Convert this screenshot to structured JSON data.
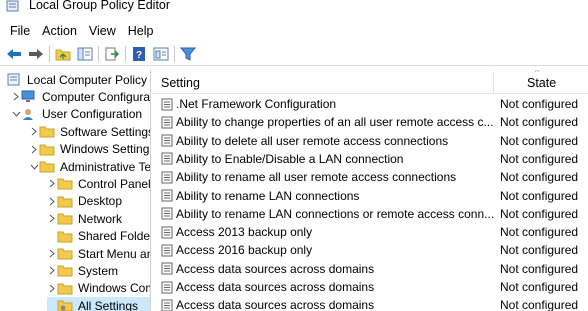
{
  "window": {
    "title": "Local Group Policy Editor"
  },
  "menu": [
    "File",
    "Action",
    "View",
    "Help"
  ],
  "toolbar": [
    {
      "name": "back-button",
      "icon": "arrow-left-icon"
    },
    {
      "name": "forward-button",
      "icon": "arrow-right-icon"
    },
    {
      "name": "up-folder-button",
      "icon": "up-folder-icon"
    },
    {
      "name": "show-hide-tree-button",
      "icon": "console-tree-icon"
    },
    {
      "name": "export-list-button",
      "icon": "export-icon"
    },
    {
      "name": "help-button",
      "icon": "help-icon"
    },
    {
      "name": "extended-view-button",
      "icon": "properties-icon"
    },
    {
      "name": "filter-button",
      "icon": "filter-icon"
    }
  ],
  "tree": [
    {
      "label": "Local Computer Policy",
      "indent": 0,
      "chev": "none",
      "icon": "computer-policy-icon"
    },
    {
      "label": "Computer Configuration",
      "indent": 1,
      "chev": "right",
      "icon": "computer-icon"
    },
    {
      "label": "User Configuration",
      "indent": 1,
      "chev": "down",
      "icon": "user-icon"
    },
    {
      "label": "Software Settings",
      "indent": 2,
      "chev": "right",
      "icon": "folder-icon"
    },
    {
      "label": "Windows Settings",
      "indent": 2,
      "chev": "right",
      "icon": "folder-icon"
    },
    {
      "label": "Administrative Templates",
      "indent": 2,
      "chev": "down",
      "icon": "folder-icon"
    },
    {
      "label": "Control Panel",
      "indent": 3,
      "chev": "right",
      "icon": "folder-icon"
    },
    {
      "label": "Desktop",
      "indent": 3,
      "chev": "right",
      "icon": "folder-icon"
    },
    {
      "label": "Network",
      "indent": 3,
      "chev": "right",
      "icon": "folder-icon"
    },
    {
      "label": "Shared Folders",
      "indent": 3,
      "chev": "none",
      "icon": "folder-icon"
    },
    {
      "label": "Start Menu and Taskbar",
      "indent": 3,
      "chev": "right",
      "icon": "folder-icon"
    },
    {
      "label": "System",
      "indent": 3,
      "chev": "right",
      "icon": "folder-icon"
    },
    {
      "label": "Windows Components",
      "indent": 3,
      "chev": "right",
      "icon": "folder-icon"
    },
    {
      "label": "All Settings",
      "indent": 3,
      "chev": "none",
      "icon": "all-settings-icon",
      "selected": true
    }
  ],
  "list": {
    "columns": {
      "setting": "Setting",
      "state": "State"
    },
    "rows": [
      {
        "setting": ".Net Framework Configuration",
        "state": "Not configured"
      },
      {
        "setting": "Ability to change properties of an all user remote access connections",
        "state": "Not configured"
      },
      {
        "setting": "Ability to delete all user remote access connections",
        "state": "Not configured"
      },
      {
        "setting": "Ability to Enable/Disable a LAN connection",
        "state": "Not configured"
      },
      {
        "setting": "Ability to rename all user remote access connections",
        "state": "Not configured"
      },
      {
        "setting": "Ability to rename LAN connections",
        "state": "Not configured"
      },
      {
        "setting": "Ability to rename LAN connections or remote access connections",
        "state": "Not configured"
      },
      {
        "setting": "Access 2013 backup only",
        "state": "Not configured"
      },
      {
        "setting": "Access 2016 backup only",
        "state": "Not configured"
      },
      {
        "setting": "Access data sources across domains",
        "state": "Not configured"
      },
      {
        "setting": "Access data sources across domains",
        "state": "Not configured"
      },
      {
        "setting": "Access data sources across domains",
        "state": "Not configured"
      }
    ]
  },
  "colors": {
    "selection": "#cce8ff",
    "folder": "#f2c94c",
    "accent": "#1e73be"
  }
}
